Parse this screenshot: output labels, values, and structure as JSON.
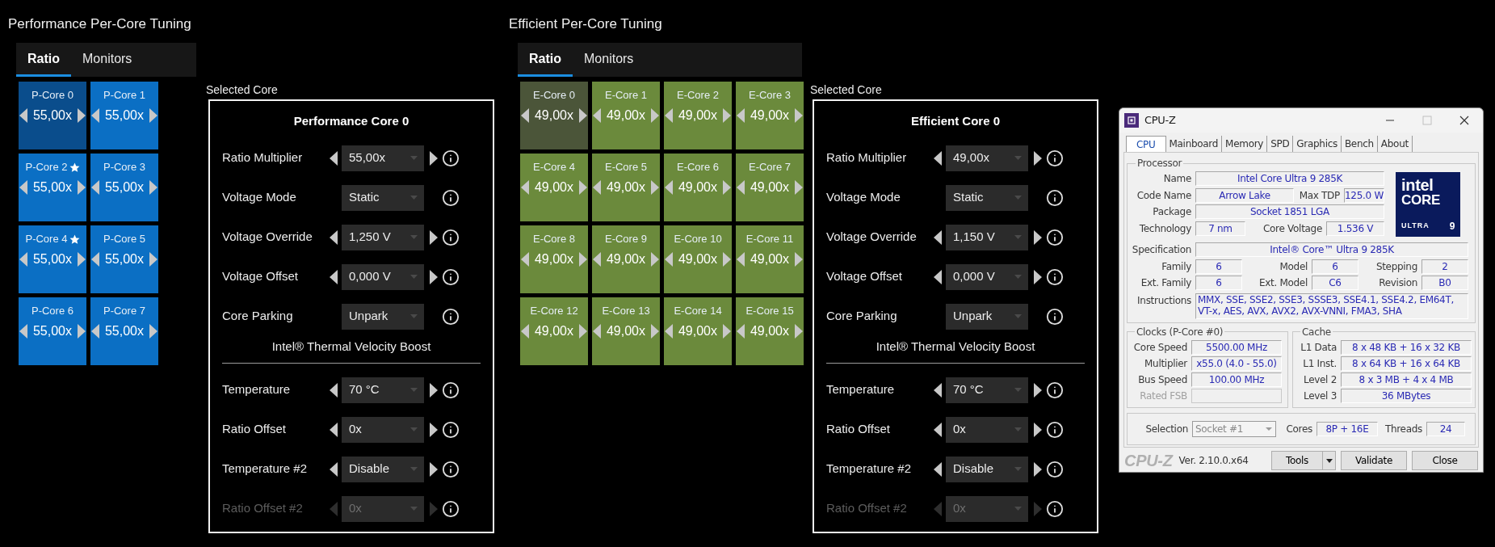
{
  "sections": [
    {
      "kind": "performance",
      "title": "Performance Per-Core Tuning",
      "tabs": [
        {
          "label": "Ratio",
          "selected": true
        },
        {
          "label": "Monitors",
          "selected": false
        }
      ],
      "cores": [
        {
          "label": "P-Core 0",
          "favored": false,
          "value": "55,00x",
          "selected": true
        },
        {
          "label": "P-Core 1",
          "favored": false,
          "value": "55,00x",
          "selected": false
        },
        {
          "label": "P-Core 2",
          "favored": true,
          "value": "55,00x",
          "selected": false
        },
        {
          "label": "P-Core 3",
          "favored": false,
          "value": "55,00x",
          "selected": false
        },
        {
          "label": "P-Core 4",
          "favored": true,
          "value": "55,00x",
          "selected": false
        },
        {
          "label": "P-Core 5",
          "favored": false,
          "value": "55,00x",
          "selected": false
        },
        {
          "label": "P-Core 6",
          "favored": false,
          "value": "55,00x",
          "selected": false
        },
        {
          "label": "P-Core 7",
          "favored": false,
          "value": "55,00x",
          "selected": false
        }
      ],
      "selected_core": {
        "caption": "Selected Core",
        "title": "Performance Core 0",
        "settings": [
          {
            "label": "Ratio Multiplier",
            "value": "55,00x",
            "stepper": true,
            "disabled": false
          },
          {
            "label": "Voltage Mode",
            "value": "Static",
            "stepper": false,
            "disabled": false
          },
          {
            "label": "Voltage Override",
            "value": "1,250 V",
            "stepper": true,
            "disabled": false
          },
          {
            "label": "Voltage Offset",
            "value": "0,000 V",
            "stepper": true,
            "disabled": false
          },
          {
            "label": "Core Parking",
            "value": "Unpark",
            "stepper": false,
            "disabled": false
          }
        ],
        "subheading": "Intel® Thermal Velocity Boost",
        "boost_settings": [
          {
            "label": "Temperature",
            "value": "70 °C",
            "stepper": true,
            "disabled": false
          },
          {
            "label": "Ratio Offset",
            "value": "0x",
            "stepper": true,
            "disabled": false
          },
          {
            "label": "Temperature #2",
            "value": "Disable",
            "stepper": true,
            "disabled": false
          },
          {
            "label": "Ratio Offset #2",
            "value": "0x",
            "stepper": true,
            "disabled": true
          }
        ]
      }
    },
    {
      "kind": "efficient",
      "title": "Efficient Per-Core Tuning",
      "tabs": [
        {
          "label": "Ratio",
          "selected": true
        },
        {
          "label": "Monitors",
          "selected": false
        }
      ],
      "cores": [
        {
          "label": "E-Core 0",
          "favored": false,
          "value": "49,00x",
          "selected": true
        },
        {
          "label": "E-Core 1",
          "favored": false,
          "value": "49,00x",
          "selected": false
        },
        {
          "label": "E-Core 2",
          "favored": false,
          "value": "49,00x",
          "selected": false
        },
        {
          "label": "E-Core 3",
          "favored": false,
          "value": "49,00x",
          "selected": false
        },
        {
          "label": "E-Core 4",
          "favored": false,
          "value": "49,00x",
          "selected": false
        },
        {
          "label": "E-Core 5",
          "favored": false,
          "value": "49,00x",
          "selected": false
        },
        {
          "label": "E-Core 6",
          "favored": false,
          "value": "49,00x",
          "selected": false
        },
        {
          "label": "E-Core 7",
          "favored": false,
          "value": "49,00x",
          "selected": false
        },
        {
          "label": "E-Core 8",
          "favored": false,
          "value": "49,00x",
          "selected": false
        },
        {
          "label": "E-Core 9",
          "favored": false,
          "value": "49,00x",
          "selected": false
        },
        {
          "label": "E-Core 10",
          "favored": false,
          "value": "49,00x",
          "selected": false
        },
        {
          "label": "E-Core 11",
          "favored": false,
          "value": "49,00x",
          "selected": false
        },
        {
          "label": "E-Core 12",
          "favored": false,
          "value": "49,00x",
          "selected": false
        },
        {
          "label": "E-Core 13",
          "favored": false,
          "value": "49,00x",
          "selected": false
        },
        {
          "label": "E-Core 14",
          "favored": false,
          "value": "49,00x",
          "selected": false
        },
        {
          "label": "E-Core 15",
          "favored": false,
          "value": "49,00x",
          "selected": false
        }
      ],
      "selected_core": {
        "caption": "Selected Core",
        "title": "Efficient Core 0",
        "settings": [
          {
            "label": "Ratio Multiplier",
            "value": "49,00x",
            "stepper": true,
            "disabled": false
          },
          {
            "label": "Voltage Mode",
            "value": "Static",
            "stepper": false,
            "disabled": false
          },
          {
            "label": "Voltage Override",
            "value": "1,150 V",
            "stepper": true,
            "disabled": false
          },
          {
            "label": "Voltage Offset",
            "value": "0,000 V",
            "stepper": true,
            "disabled": false
          },
          {
            "label": "Core Parking",
            "value": "Unpark",
            "stepper": false,
            "disabled": false
          }
        ],
        "subheading": "Intel® Thermal Velocity Boost",
        "boost_settings": [
          {
            "label": "Temperature",
            "value": "70 °C",
            "stepper": true,
            "disabled": false
          },
          {
            "label": "Ratio Offset",
            "value": "0x",
            "stepper": true,
            "disabled": false
          },
          {
            "label": "Temperature #2",
            "value": "Disable",
            "stepper": true,
            "disabled": false
          },
          {
            "label": "Ratio Offset #2",
            "value": "0x",
            "stepper": true,
            "disabled": true
          }
        ]
      }
    }
  ],
  "cpuz": {
    "title": "CPU-Z",
    "tabs": [
      {
        "label": "CPU",
        "selected": true
      },
      {
        "label": "Mainboard",
        "selected": false
      },
      {
        "label": "Memory",
        "selected": false
      },
      {
        "label": "SPD",
        "selected": false
      },
      {
        "label": "Graphics",
        "selected": false
      },
      {
        "label": "Bench",
        "selected": false
      },
      {
        "label": "About",
        "selected": false
      }
    ],
    "processor": {
      "legend": "Processor",
      "name": {
        "label": "Name",
        "value": "Intel Core Ultra 9 285K"
      },
      "code_name": {
        "label": "Code Name",
        "value": "Arrow Lake"
      },
      "max_tdp": {
        "label": "Max TDP",
        "value": "125.0 W"
      },
      "package": {
        "label": "Package",
        "value": "Socket 1851 LGA"
      },
      "technology": {
        "label": "Technology",
        "value": "7 nm"
      },
      "core_voltage": {
        "label": "Core Voltage",
        "value": "1.536 V"
      },
      "specification": {
        "label": "Specification",
        "value": "Intel® Core™ Ultra 9 285K"
      },
      "family": {
        "label": "Family",
        "value": "6"
      },
      "model": {
        "label": "Model",
        "value": "6"
      },
      "stepping": {
        "label": "Stepping",
        "value": "2"
      },
      "ext_family": {
        "label": "Ext. Family",
        "value": "6"
      },
      "ext_model": {
        "label": "Ext. Model",
        "value": "C6"
      },
      "revision": {
        "label": "Revision",
        "value": "B0"
      },
      "instructions": {
        "label": "Instructions",
        "value": "MMX, SSE, SSE2, SSE3, SSSE3, SSE4.1, SSE4.2, EM64T, VT-x, AES, AVX, AVX2, AVX-VNNI, FMA3, SHA"
      }
    },
    "logo": {
      "brand": "intel",
      "line": "CORE",
      "tier": "ULTRA",
      "number": "9"
    },
    "clocks": {
      "legend": "Clocks (P-Core #0)",
      "rows": [
        {
          "label": "Core Speed",
          "value": "5500.00 MHz",
          "disabled": false
        },
        {
          "label": "Multiplier",
          "value": "x55.0 (4.0 - 55.0)",
          "disabled": false
        },
        {
          "label": "Bus Speed",
          "value": "100.00 MHz",
          "disabled": false
        },
        {
          "label": "Rated FSB",
          "disabled": true
        }
      ]
    },
    "cache": {
      "legend": "Cache",
      "rows": [
        {
          "label": "L1 Data",
          "value": "8 x 48 KB + 16 x 32 KB"
        },
        {
          "label": "L1 Inst.",
          "value": "8 x 64 KB + 16 x 64 KB"
        },
        {
          "label": "Level 2",
          "value": "8 x 3 MB + 4 x 4 MB"
        },
        {
          "label": "Level 3",
          "value": "36 MBytes"
        }
      ]
    },
    "selection": {
      "label": "Selection",
      "value": "Socket #1",
      "disabled": true
    },
    "cores": {
      "label": "Cores",
      "value": "8P + 16E"
    },
    "threads": {
      "label": "Threads",
      "value": "24"
    },
    "brand": "CPU-Z",
    "version": "Ver. 2.10.0.x64",
    "buttons": [
      {
        "label": "Tools",
        "kind": "split"
      },
      {
        "label": "Validate",
        "kind": "plain"
      },
      {
        "label": "Close",
        "kind": "plain"
      }
    ]
  }
}
